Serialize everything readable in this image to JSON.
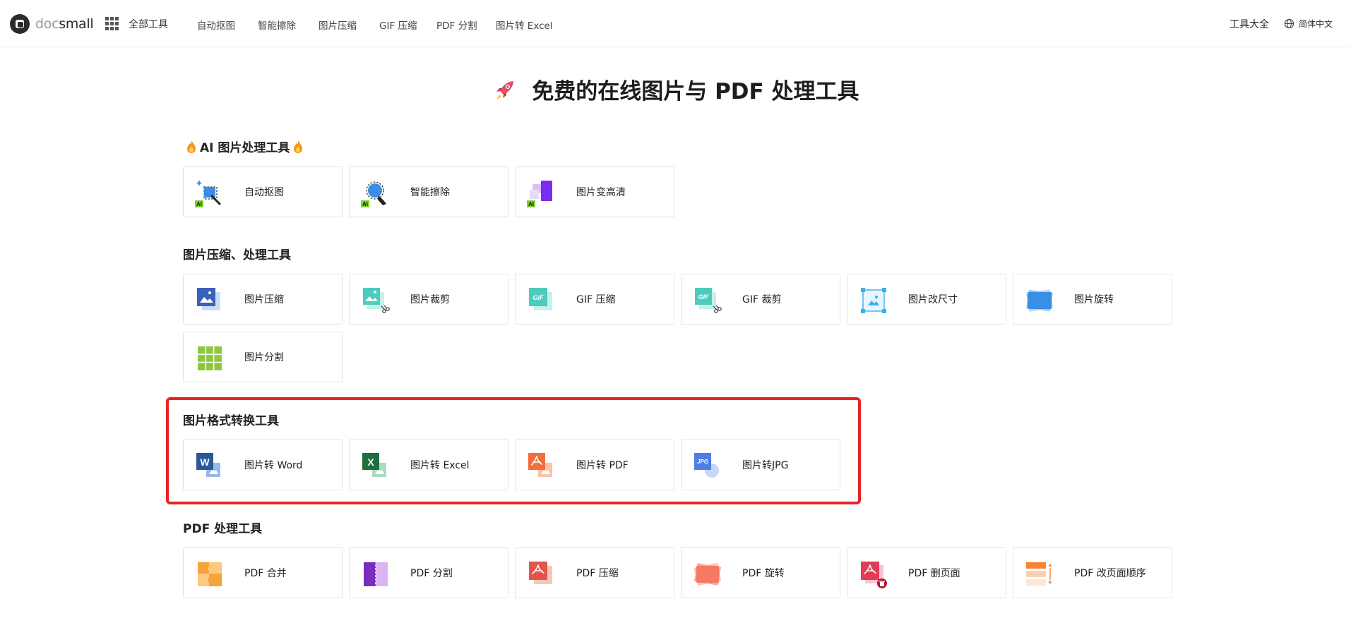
{
  "header": {
    "logo_doc": "doc",
    "logo_small": "small",
    "all_tools": "全部工具",
    "nav": [
      "自动抠图",
      "智能擦除",
      "图片压缩",
      "GIF 压缩",
      "PDF 分割",
      "图片转 Excel"
    ],
    "tools_all": "工具大全",
    "language": "简体中文"
  },
  "hero": {
    "title": "免费的在线图片与 PDF 处理工具"
  },
  "sections": {
    "ai": {
      "title": "AI 图片处理工具",
      "items": [
        "自动抠图",
        "智能擦除",
        "图片变高清"
      ]
    },
    "image": {
      "title": "图片压缩、处理工具",
      "items": [
        "图片压缩",
        "图片裁剪",
        "GIF 压缩",
        "GIF 裁剪",
        "图片改尺寸",
        "图片旋转",
        "图片分割"
      ]
    },
    "convert": {
      "title": "图片格式转换工具",
      "items": [
        "图片转 Word",
        "图片转 Excel",
        "图片转 PDF",
        "图片转JPG"
      ]
    },
    "pdf": {
      "title": "PDF 处理工具",
      "items": [
        "PDF 合并",
        "PDF 分割",
        "PDF 压缩",
        "PDF 旋转",
        "PDF 删页面",
        "PDF 改页面顺序"
      ]
    }
  },
  "icons": {
    "ai": [
      "ai-cutout-icon",
      "ai-erase-icon",
      "ai-enhance-icon"
    ],
    "image": [
      "image-compress-icon",
      "image-crop-icon",
      "gif-compress-icon",
      "gif-crop-icon",
      "image-resize-icon",
      "image-rotate-icon",
      "image-split-icon"
    ],
    "convert": [
      "word-icon",
      "excel-icon",
      "pdf-icon",
      "jpg-icon"
    ],
    "pdf": [
      "pdf-merge-icon",
      "pdf-split-icon",
      "pdf-compress-icon",
      "pdf-rotate-icon",
      "pdf-delete-page-icon",
      "pdf-reorder-icon"
    ]
  },
  "icon_text": {
    "ai_badge": "AI",
    "gif": "GIF",
    "word": "W",
    "excel": "X",
    "jpg": "JPG"
  },
  "colors": {
    "highlight": "#e62424",
    "word": "#2b579a",
    "excel": "#1d6f42",
    "pdf": "#f06f3c",
    "jpg": "#4e7de3",
    "gif": "#45c9b6",
    "ai_badge": "#7cd32a"
  }
}
